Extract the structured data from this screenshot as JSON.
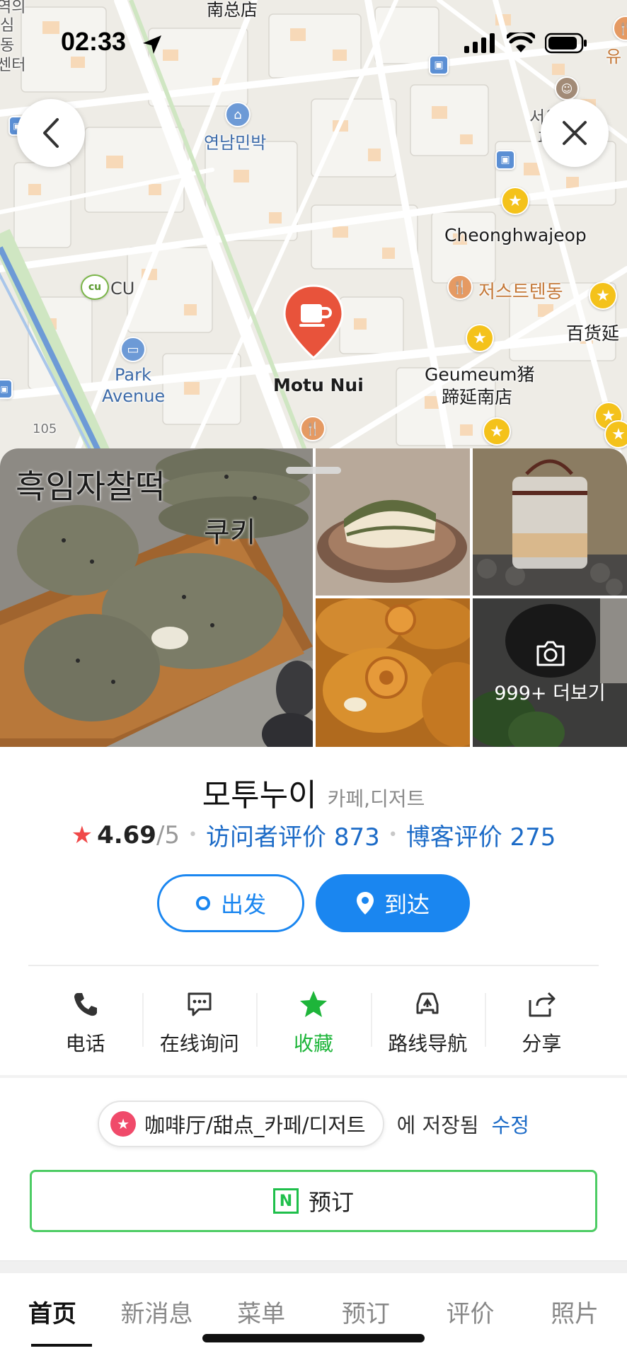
{
  "status_bar": {
    "time": "02:33"
  },
  "map": {
    "labels": {
      "top_store": "南总店",
      "lodging": "연남민박",
      "cheonghwajeop": "Cheonghwajeop",
      "jjst": "저스트텐동",
      "dept": "百货延",
      "cu": "CU",
      "park1": "Park",
      "park2": "Avenue",
      "geumeum1": "Geumeum猪",
      "geumeum2": "蹄延南店",
      "road_no": "105",
      "seoul1": "서울",
      "seoul2": "퍼",
      "left_frag1": "역의",
      "left_frag2": "심",
      "left_frag3": "동",
      "left_frag4": "센터",
      "right_top": "유",
      "cu_badge": "cu"
    },
    "marker": {
      "name": "Motu Nui"
    },
    "colors": {
      "marker": "#e8533b",
      "star": "#f4c21b",
      "road": "#ffffff",
      "block": "#f7d9b8"
    }
  },
  "photos": {
    "more_label": "999+ 더보기",
    "overlay_text_1": "흑임자찰떡",
    "overlay_text_2": "쿠키"
  },
  "place": {
    "name": "모투누이",
    "category": "카페,디저트",
    "rating": "4.69",
    "rating_max": "/5",
    "visitor_reviews": "访问者评价 873",
    "blog_reviews": "博客评价 275"
  },
  "buttons": {
    "depart": "出发",
    "arrive": "到达"
  },
  "actions": [
    {
      "label": "电话",
      "icon": "phone-icon"
    },
    {
      "label": "在线询问",
      "icon": "chat-icon"
    },
    {
      "label": "收藏",
      "icon": "star-icon"
    },
    {
      "label": "路线导航",
      "icon": "car-route-icon"
    },
    {
      "label": "分享",
      "icon": "share-icon"
    }
  ],
  "saved": {
    "chip": "咖啡厅/甜点_카페/디저트",
    "text": "에 저장됨",
    "edit": "수정"
  },
  "reserve": {
    "label": "预订",
    "icon_letter": "N"
  },
  "tabs": [
    "首页",
    "新消息",
    "菜单",
    "预订",
    "评价",
    "照片"
  ],
  "accent": "#1a86f0"
}
